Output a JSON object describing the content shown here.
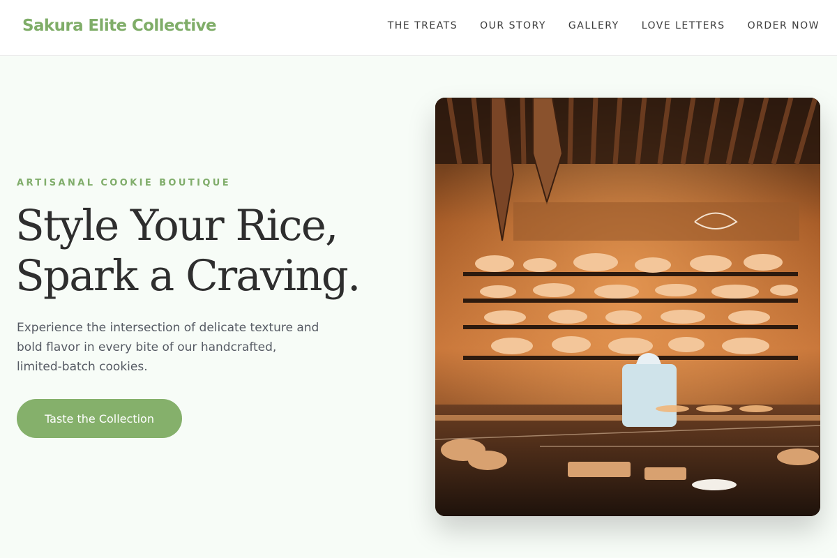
{
  "header": {
    "brand": "Sakura Elite Collective",
    "nav": [
      {
        "label": "THE TREATS"
      },
      {
        "label": "OUR STORY"
      },
      {
        "label": "GALLERY"
      },
      {
        "label": "LOVE LETTERS"
      },
      {
        "label": "ORDER NOW"
      }
    ]
  },
  "hero": {
    "eyebrow": "ARTISANAL COOKIE BOUTIQUE",
    "headline_line1": "Style Your Rice,",
    "headline_line2": "Spark a Craving.",
    "lead": "Experience the intersection of delicate texture and bold flavor in every bite of our handcrafted, limited-batch cookies.",
    "cta_label": "Taste the Collection"
  },
  "colors": {
    "accent": "#85b06b",
    "background": "#f7fcf7",
    "text": "#2e2e2e"
  }
}
